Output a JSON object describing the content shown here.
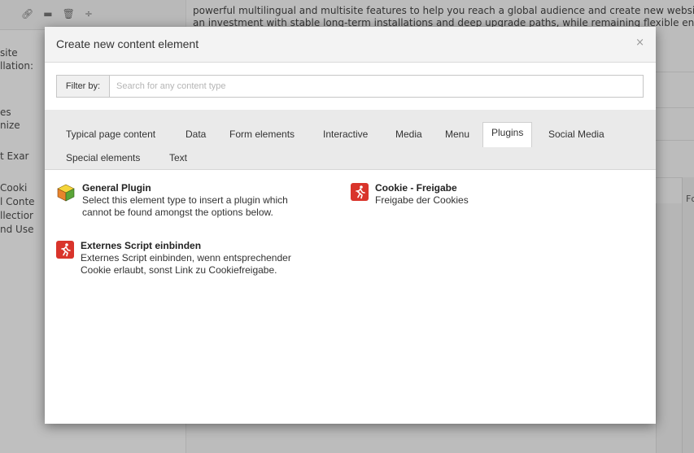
{
  "background": {
    "toolbar_icons": [
      "link-icon",
      "folder-icon",
      "trash-icon",
      "divide-icon"
    ],
    "tree_items": [
      {
        "label": "site"
      },
      {
        "label": "llation:"
      },
      {
        "label": "es"
      },
      {
        "label": "nize"
      },
      {
        "label": "t Exar"
      },
      {
        "label": "Cooki"
      },
      {
        "label": "l Conte"
      },
      {
        "label": "llectior"
      },
      {
        "label": "nd Use"
      }
    ],
    "intro_line_1": "powerful multilingual and multisite features to help you reach a global audience and create new website",
    "intro_line_2": "an investment with stable long-term installations and deep upgrade paths, while remaining flexible enou",
    "right_fragment": "Fc"
  },
  "modal": {
    "title": "Create new content element",
    "close_symbol": "×",
    "filter": {
      "label": "Filter by:",
      "placeholder": "Search for any content type",
      "value": ""
    },
    "tabs": [
      {
        "label": "Typical page content",
        "active": false
      },
      {
        "label": "Data",
        "active": false
      },
      {
        "label": "Form elements",
        "active": false
      },
      {
        "label": "Interactive",
        "active": false
      },
      {
        "label": "Media",
        "active": false
      },
      {
        "label": "Menu",
        "active": false
      },
      {
        "label": "Plugins",
        "active": true
      },
      {
        "label": "Social Media",
        "active": false
      },
      {
        "label": "Special elements",
        "active": false
      },
      {
        "label": "Text",
        "active": false
      }
    ],
    "elements": [
      {
        "title": "General Plugin",
        "description": "Select this element type to insert a plugin which\ncannot be found amongst the options below.",
        "icon": "cube-icon"
      },
      {
        "title": "Cookie - Freigabe",
        "description": "Freigabe der Cookies",
        "icon": "plugin-runner-icon"
      },
      {
        "title": "Externes Script einbinden",
        "description": "Externes Script einbinden, wenn entsprechender\nCookie erlaubt, sonst Link zu Cookiefreigabe.",
        "icon": "plugin-runner-icon"
      }
    ]
  },
  "colors": {
    "plugin_icon": "#d9342b",
    "cube_top": "#f4d53a",
    "cube_left": "#e8842c",
    "cube_right": "#5aa538"
  }
}
